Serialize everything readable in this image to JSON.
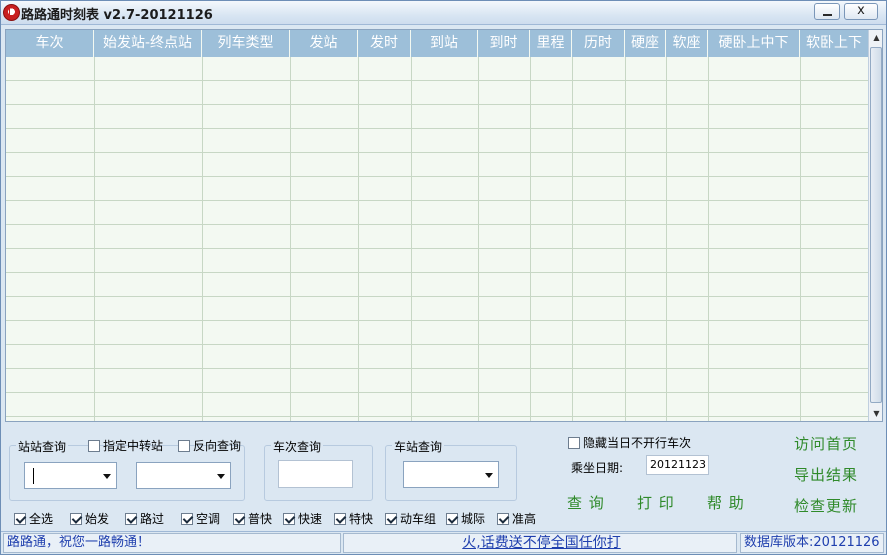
{
  "window": {
    "title": "路路通时刻表 v2.7-20121126",
    "minimize": "",
    "close": "x"
  },
  "table": {
    "columns": [
      "车次",
      "始发站-终点站",
      "列车类型",
      "发站",
      "发时",
      "到站",
      "到时",
      "里程",
      "历时",
      "硬座",
      "软座",
      "硬卧上中下",
      "软卧上下"
    ],
    "rows": []
  },
  "station_query": {
    "title": "站站查询",
    "via_label": "指定中转站",
    "reverse_label": "反向查询",
    "from_value": "",
    "to_value": ""
  },
  "train_query": {
    "title": "车次查询",
    "value": ""
  },
  "stop_query": {
    "title": "车站查询",
    "value": ""
  },
  "options": {
    "hide_label": "隐藏当日不开行车次",
    "date_label": "乘坐日期:",
    "date_value": "20121123"
  },
  "actions": {
    "query": "查 询",
    "print": "打 印",
    "help": "帮 助",
    "visit_home": "访问首页",
    "export": "导出结果",
    "check_update": "检查更新"
  },
  "filters": [
    {
      "label": "全选",
      "checked": true
    },
    {
      "label": "始发",
      "checked": true
    },
    {
      "label": "路过",
      "checked": true
    },
    {
      "label": "空调",
      "checked": true
    },
    {
      "label": "普快",
      "checked": true
    },
    {
      "label": "快速",
      "checked": true
    },
    {
      "label": "特快",
      "checked": true
    },
    {
      "label": "动车组",
      "checked": true
    },
    {
      "label": "城际",
      "checked": true
    },
    {
      "label": "准高",
      "checked": true
    }
  ],
  "status": {
    "greeting": "路路通，祝您一路畅通！",
    "ad": "火,话费送不停全国任你打",
    "db_version": "数据库版本:20121126"
  }
}
